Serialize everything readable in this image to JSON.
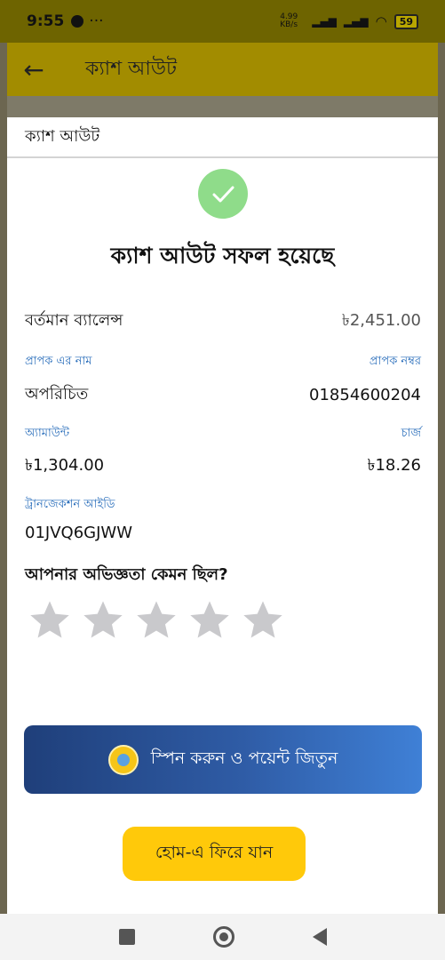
{
  "status_bar": {
    "time": "9:55",
    "messenger_icon": "messenger-icon",
    "more": "···",
    "net_speed": "4.99 KB/s",
    "battery": "59"
  },
  "app_bar": {
    "title": "ক্যাশ আউট"
  },
  "sheet": {
    "title": "ক্যাশ আউট",
    "success_message": "ক্যাশ আউট সফল হয়েছে",
    "balance": {
      "label": "বর্তমান ব্যালেন্স",
      "value": "৳2,451.00"
    },
    "recipient": {
      "name_label": "প্রাপক এর নাম",
      "number_label": "প্রাপক নম্বর",
      "name": "অপরিচিত",
      "number": "01854600204"
    },
    "amount": {
      "amount_label": "অ্যামাউন্ট",
      "charge_label": "চার্জ",
      "amount": "৳1,304.00",
      "charge": "৳18.26"
    },
    "transaction": {
      "label": "ট্রানজেকশন আইডি",
      "id": "01JVQ6GJWW"
    },
    "rating": {
      "question": "আপনার অভিজ্ঞতা কেমন ছিল?",
      "stars_selected": 0,
      "stars_total": 5
    },
    "spin_button": "স্পিন করুন ও পয়েন্ট জিতুন",
    "home_button": "হোম-এ ফিরে যান"
  },
  "colors": {
    "accent_yellow": "#ffc90a",
    "label_blue": "#2a6ebb",
    "success_green": "#8fdc8a",
    "star_grey": "#c9c9cc"
  }
}
